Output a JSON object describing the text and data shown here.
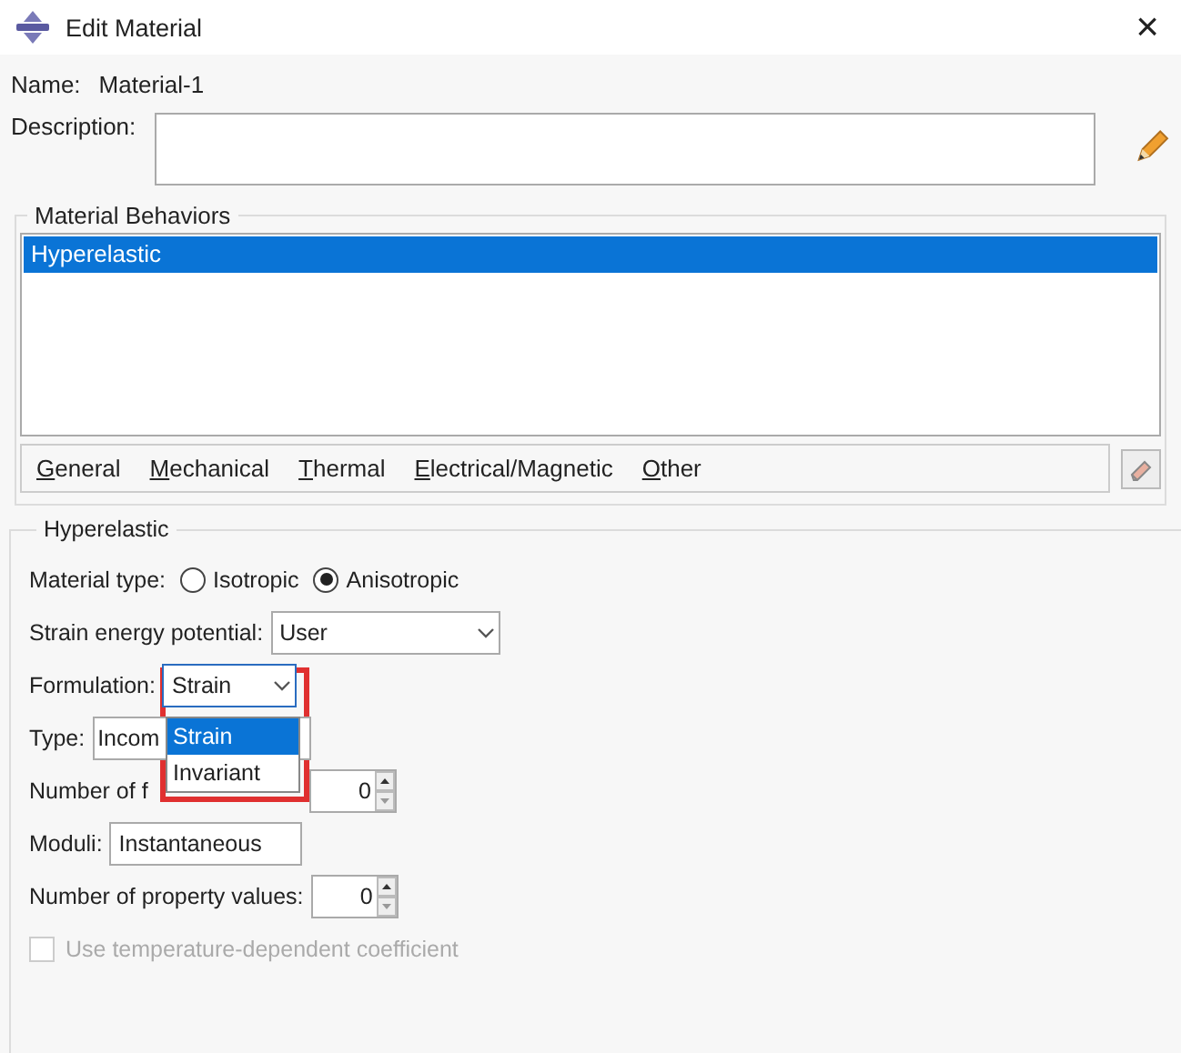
{
  "window": {
    "title": "Edit Material",
    "close": "×"
  },
  "name": {
    "label": "Name:",
    "value": "Material-1"
  },
  "description": {
    "label": "Description:"
  },
  "behaviors": {
    "title": "Material Behaviors",
    "items": [
      {
        "label": "Hyperelastic",
        "selected": true
      }
    ],
    "menus": [
      {
        "mnemonic": "G",
        "rest": "eneral"
      },
      {
        "mnemonic": "M",
        "rest": "echanical"
      },
      {
        "mnemonic": "T",
        "rest": "hermal"
      },
      {
        "mnemonic": "E",
        "rest": "lectrical/Magnetic"
      },
      {
        "mnemonic": "O",
        "rest": "ther"
      }
    ]
  },
  "panel": {
    "title": "Hyperelastic",
    "material_type": {
      "label": "Material type:",
      "options": [
        {
          "label": "Isotropic",
          "selected": false
        },
        {
          "label": "Anisotropic",
          "selected": true
        }
      ]
    },
    "rows": [
      {
        "kind": "combo",
        "label": "Strain energy potential:",
        "value": "User"
      },
      {
        "kind": "combo",
        "label": "Formulation:",
        "value": "Strain",
        "focused": true
      },
      {
        "kind": "field",
        "label": "Type:",
        "value": "Incom"
      },
      {
        "kind": "spinner",
        "label": "Number of f",
        "value": "0"
      },
      {
        "kind": "field",
        "label": "Moduli:",
        "value": "Instantaneous"
      },
      {
        "kind": "spinner",
        "label": "Number of property values:",
        "value": "0"
      },
      {
        "kind": "checkbox",
        "label": "Use temperature-dependent coefficient",
        "checked": false,
        "disabled": true
      }
    ]
  },
  "dropdown": {
    "options": [
      {
        "label": "Strain",
        "selected": true
      },
      {
        "label": "Invariant",
        "selected": false
      }
    ],
    "highlighted": true
  }
}
